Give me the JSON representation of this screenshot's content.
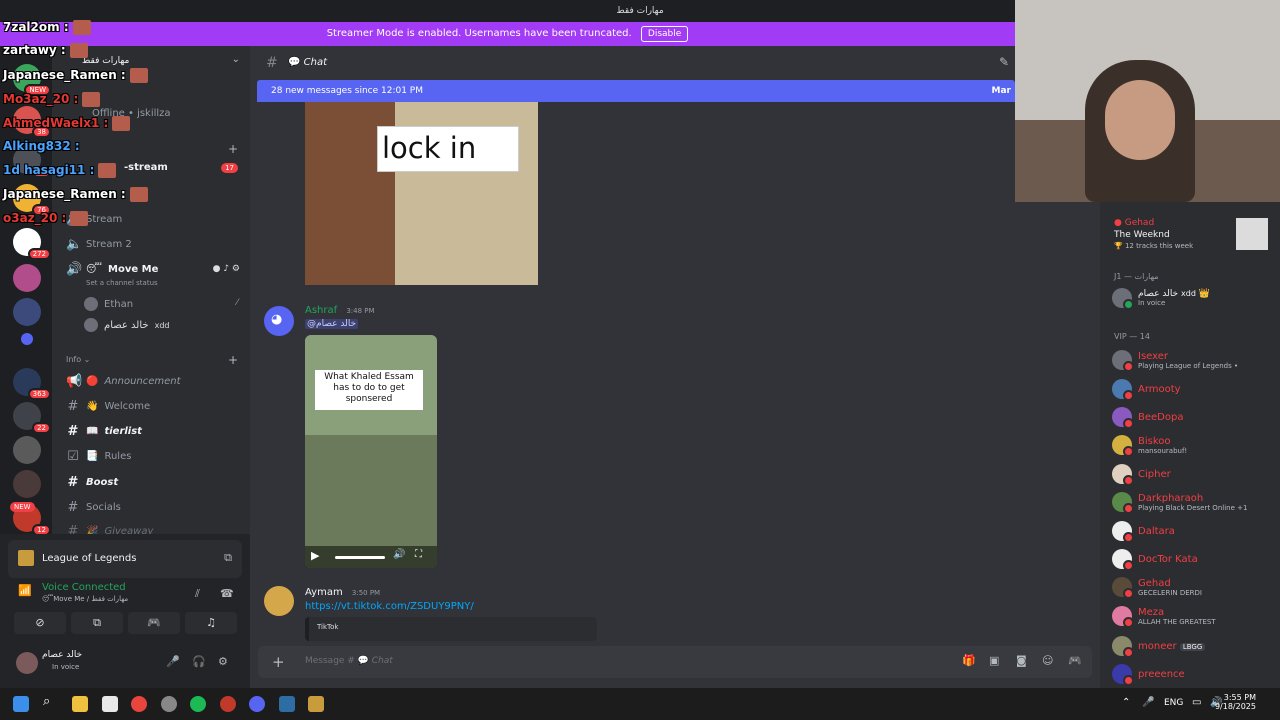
{
  "window": {
    "title": "مهارات فقط"
  },
  "banner": {
    "text": "Streamer Mode is enabled. Usernames have been truncated.",
    "button": "Disable"
  },
  "server": {
    "name": "مهارات فقط"
  },
  "guild_badges": [
    "NEW",
    "38",
    "CS",
    "76",
    "272",
    "363",
    "22",
    "NEW",
    "12"
  ],
  "channels": {
    "offline_user": "Offline • jskillza",
    "stream_label": "-stream",
    "stream_badge": "17",
    "stream1": "Stream",
    "stream2": "Stream 2",
    "move_me": "Move Me",
    "move_me_emoji": "😴",
    "channel_status": "Set a channel status",
    "voice_users": [
      "Ethan",
      "خالد عصام"
    ],
    "voice_user_tag": "xdd",
    "category_info": "Info",
    "list": [
      {
        "name": "Announcement",
        "emoji": "🔴"
      },
      {
        "name": "Welcome",
        "emoji": "👋"
      },
      {
        "name": "tierlist",
        "emoji": "📖"
      },
      {
        "name": "Rules",
        "emoji": "📑"
      },
      {
        "name": "Boost",
        "emoji": ""
      },
      {
        "name": "Socials",
        "emoji": ""
      },
      {
        "name": "Giveaway",
        "emoji": "🎉"
      }
    ]
  },
  "overlay_chat": [
    {
      "user": "7zal2om :"
    },
    {
      "user": "zartawy :"
    },
    {
      "user": "Japanese_Ramen :"
    },
    {
      "user": "Mo3az_20 :"
    },
    {
      "user": "AhmedWaelx1 :"
    },
    {
      "user": "Alking832 :"
    },
    {
      "user": "1d hasagi11 :"
    },
    {
      "user": "Japanese_Ramen :"
    },
    {
      "user": "o3az_20 :"
    }
  ],
  "activity": {
    "game": "League of Legends"
  },
  "voice": {
    "status": "Voice Connected",
    "channel": "😴Move Me / مهارات فقط"
  },
  "user": {
    "name": "خالد عصام",
    "status": "In voice"
  },
  "chat": {
    "channel_name": "Chat",
    "new_messages": "28 new messages since 12:01 PM",
    "new_messages_right": "Mar",
    "meme_text": "lock in",
    "messages": [
      {
        "author": "Ashraf",
        "time": "3:48 PM",
        "mention": "@خالد عصام",
        "video_caption": "What Khaled Essam has to do to get sponsered"
      },
      {
        "author": "Aymam",
        "time": "3:50 PM",
        "link": "https://vt.tiktok.com/ZSDUY9PNY/",
        "embed_provider": "TikTok"
      }
    ],
    "input_placeholder": "Message #",
    "input_channel": "Chat"
  },
  "members": {
    "now_playing": {
      "user": "Gehad",
      "title": "The Weeknd",
      "sub": "12 tracks this week"
    },
    "j1_header": "J1 — مهارات",
    "j1_member": {
      "name": "خالد عصام",
      "tag": "xdd",
      "status": "In voice"
    },
    "vip_header": "VIP — 14",
    "vip": [
      {
        "name": "Isexer",
        "sub": "Playing League of Legends •"
      },
      {
        "name": "Armooty",
        "sub": ""
      },
      {
        "name": "BeeDopa",
        "sub": ""
      },
      {
        "name": "Biskoo",
        "sub": "mansourabuf!"
      },
      {
        "name": "Cipher",
        "sub": ""
      },
      {
        "name": "Darkpharaoh",
        "sub": "Playing Black Desert Online +1"
      },
      {
        "name": "Daltara",
        "sub": ""
      },
      {
        "name": "DocTor Kata",
        "sub": ""
      },
      {
        "name": "Gehad",
        "sub": "GECELERIN DERDI"
      },
      {
        "name": "Meza",
        "sub": "ALLAH THE GREATEST"
      },
      {
        "name": "moneer",
        "sub": "",
        "tag": "LBGG"
      },
      {
        "name": "preeence",
        "sub": ""
      }
    ]
  },
  "taskbar": {
    "lang": "ENG",
    "time": "3:55 PM",
    "date": "9/18/2025"
  }
}
